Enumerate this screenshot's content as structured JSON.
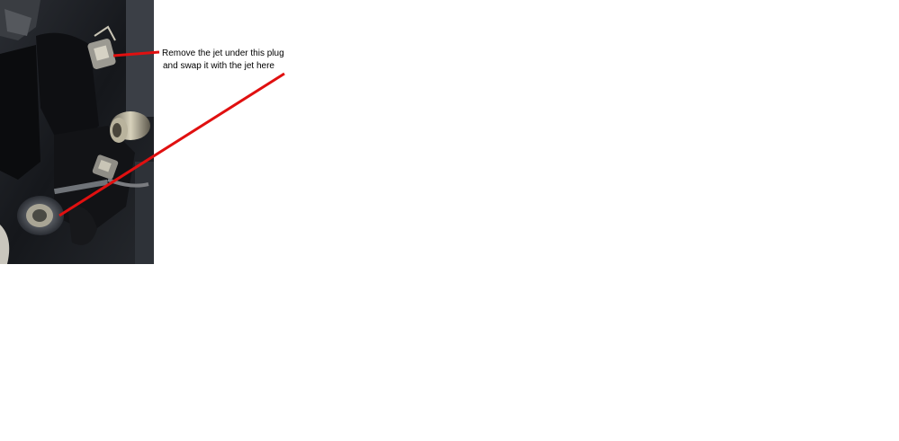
{
  "annotation": {
    "lines": [
      "Remove the jet under this plug",
      "and swap it with the jet here"
    ]
  },
  "colors": {
    "arrow": "#e01010",
    "text": "#000000",
    "background": "#ffffff"
  }
}
